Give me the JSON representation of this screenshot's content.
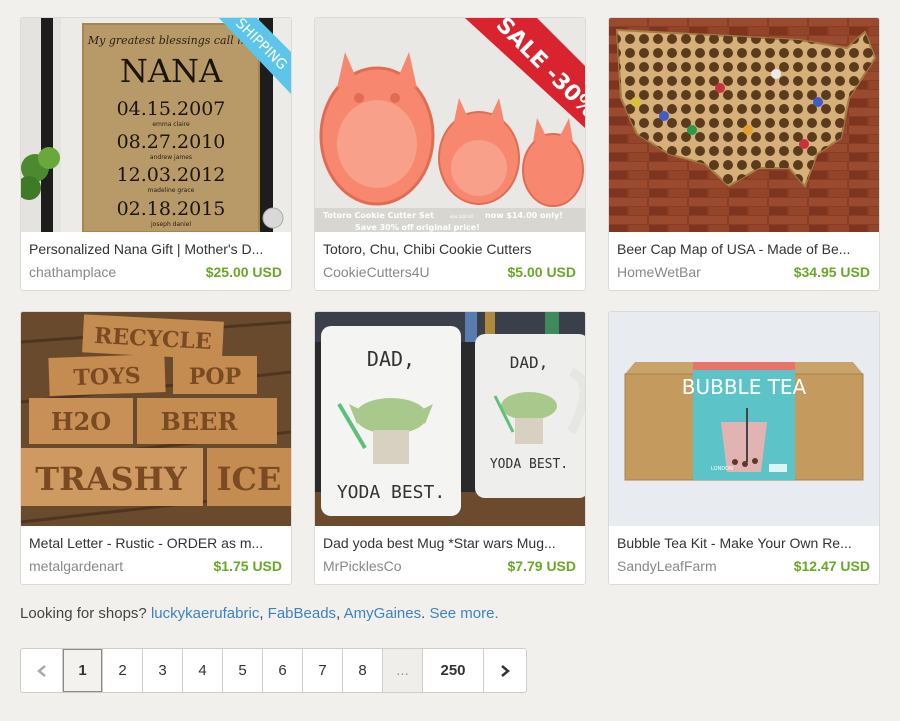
{
  "listings": [
    {
      "title": "Personalized Nana Gift | Mother's D...",
      "shop": "chathamplace",
      "price": "$25.00 USD",
      "ribbon": "SHIPPING",
      "image_text": {
        "top": "My greatest blessings call me",
        "name": "NANA",
        "dates": [
          "04.15.2007",
          "08.27.2010",
          "12.03.2012",
          "02.18.2015"
        ],
        "names": [
          "emma claire",
          "andrew james",
          "madeline grace",
          "joseph daniel"
        ]
      }
    },
    {
      "title": "Totoro, Chu, Chibi Cookie Cutters",
      "shop": "CookieCutters4U",
      "price": "$5.00 USD",
      "ribbon": "SALE -30%",
      "image_text": {
        "caption1": "Totoro Cookie Cutter Set",
        "caption1b": "was $20.00",
        "caption1c": "now $14.00 only!",
        "caption2": "Save 30% off original price!"
      }
    },
    {
      "title": "Beer Cap Map of USA - Made of Be...",
      "shop": "HomeWetBar",
      "price": "$34.95 USD"
    },
    {
      "title": "Metal Letter - Rustic - ORDER as m...",
      "shop": "metalgardenart",
      "price": "$1.75 USD",
      "image_text": {
        "signs": [
          "RECYCLE",
          "TOYS",
          "POP",
          "H2O",
          "BEER",
          "TRASHY",
          "ICE"
        ]
      }
    },
    {
      "title": "Dad yoda best Mug *Star wars Mug...",
      "shop": "MrPicklesCo",
      "price": "$7.79 USD",
      "image_text": {
        "top": "DAD,",
        "bottom": "YODA BEST."
      }
    },
    {
      "title": "Bubble Tea Kit - Make Your Own Re...",
      "shop": "SandyLeafFarm",
      "price": "$12.47 USD",
      "image_text": {
        "headline": "BUBBLE TEA",
        "brand": "LONDON"
      }
    }
  ],
  "shops_line": {
    "prefix": "Looking for shops?",
    "shops": [
      "luckykaerufabric",
      "FabBeads",
      "AmyGaines"
    ],
    "see_more": "See more."
  },
  "pagination": {
    "pages": [
      "1",
      "2",
      "3",
      "4",
      "5",
      "6",
      "7",
      "8"
    ],
    "ellipsis": "...",
    "last": "250",
    "current": "1"
  },
  "colors": {
    "price": "#67a825",
    "link": "#3d83c4",
    "ribbon_blue": "#5bc6ea",
    "ribbon_red": "#d9232e",
    "background": "#f1f0ed"
  }
}
